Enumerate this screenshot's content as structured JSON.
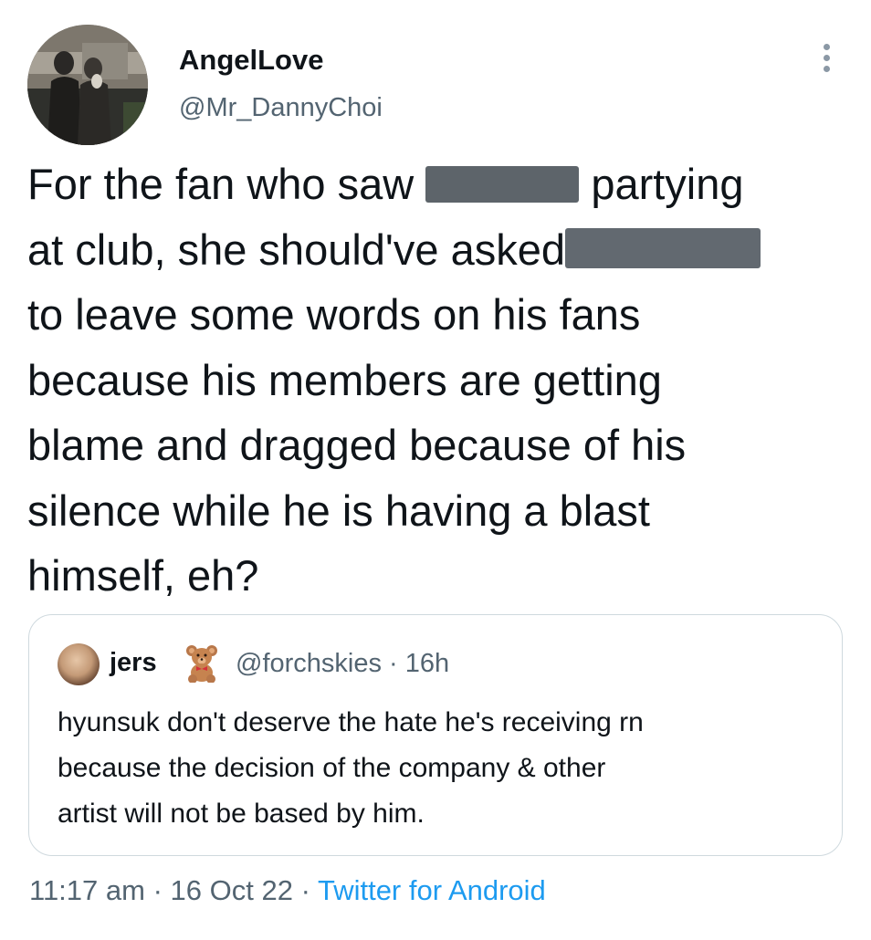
{
  "author": {
    "display_name": "AngelLove",
    "handle": "@Mr_DannyChoi"
  },
  "tweet": {
    "seg1": "For the fan who saw ",
    "seg2": " partying\nat club, she should've asked",
    "seg3": "\nto leave some words on his fans\nbecause his members are getting\nblame and dragged because of his\nsilence while he is having a blast\nhimself, eh?"
  },
  "quote": {
    "name": "jers",
    "emoji_icon": "teddy-bear-icon",
    "handle": "@forchskies",
    "sep": "·",
    "time": "16h",
    "text": "hyunsuk don't deserve the hate he's receiving rn\nbecause the decision of the company & other\nartist will not be based by him."
  },
  "footer": {
    "time": "11:17 am",
    "sep": "·",
    "date": "16 Oct 22",
    "source": "Twitter for Android"
  },
  "colors": {
    "text": "#0f1419",
    "secondary": "#536471",
    "link": "#1d9bf0",
    "border": "#cfd9de",
    "redaction": "#5d646a"
  }
}
